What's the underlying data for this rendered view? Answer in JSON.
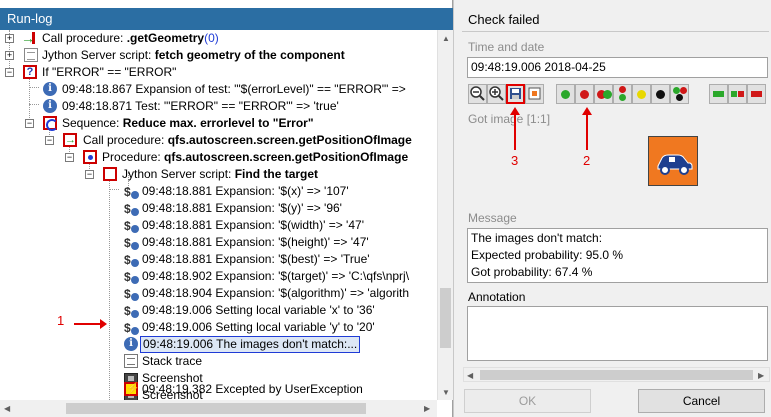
{
  "run_log": {
    "title": "Run-log",
    "nodes": [
      {
        "text": "Call procedure: ",
        "bold": ".getGeometry",
        "suffix": "(0)"
      },
      {
        "text": "Jython Server script: ",
        "bold": "fetch geometry of the component"
      },
      {
        "text": "If \"ERROR\" == \"ERROR\""
      },
      {
        "text": "09:48:18.867 Expansion of test: '\"$(errorLevel)\" == \"ERROR\"' =>"
      },
      {
        "text": "09:48:18.871 Test: '\"ERROR\" == \"ERROR\"' => 'true'"
      },
      {
        "text": "Sequence: ",
        "bold": "Reduce max. errorlevel to \"Error\""
      },
      {
        "text": "Call procedure: ",
        "bold": "qfs.autoscreen.screen.getPositionOfImage"
      },
      {
        "text": "Procedure: ",
        "bold": "qfs.autoscreen.screen.getPositionOfImage"
      },
      {
        "text": "Jython Server script: ",
        "bold": "Find the target"
      },
      {
        "text": "09:48:18.881 Expansion: '$(x)' => '107'"
      },
      {
        "text": "09:48:18.881 Expansion: '$(y)' => '96'"
      },
      {
        "text": "09:48:18.881 Expansion: '$(width)' => '47'"
      },
      {
        "text": "09:48:18.881 Expansion: '$(height)' => '47'"
      },
      {
        "text": "09:48:18.881 Expansion: '$(best)' => 'True'"
      },
      {
        "text": "09:48:18.902 Expansion: '$(target)' => 'C:\\qfs\\nprj\\"
      },
      {
        "text": "09:48:18.904 Expansion: '$(algorithm)' => 'algorith"
      },
      {
        "text": "09:48:19.006 Setting local variable 'x' to '36'"
      },
      {
        "text": "09:48:19.006 Setting local variable 'y' to '20'"
      },
      {
        "text": "09:48:19.006 The images don't match:..."
      },
      {
        "text": "Stack trace"
      },
      {
        "text": "Screenshot"
      },
      {
        "text": "Screenshot"
      },
      {
        "text": "09:48:19.382 Excepted by UserException"
      }
    ]
  },
  "annotations": {
    "one": "1",
    "two": "2",
    "three": "3",
    "color": "#e00000"
  },
  "details": {
    "title": "Check failed",
    "time_label": "Time and date",
    "time_value": "09:48:19.006  2018-04-25",
    "image_label": "Got image [1:1]",
    "message_label": "Message",
    "message_lines": [
      "The images don't match:",
      "Expected probability: 95.0 %",
      "Got probability: 67.4 %"
    ],
    "annotation_label": "Annotation",
    "annotation_value": "",
    "ok_label": "OK",
    "cancel_label": "Cancel"
  },
  "colors": {
    "title_bar": "#2b6ea3",
    "selection": "#1f3bd6",
    "image_bg": "#f07820"
  }
}
